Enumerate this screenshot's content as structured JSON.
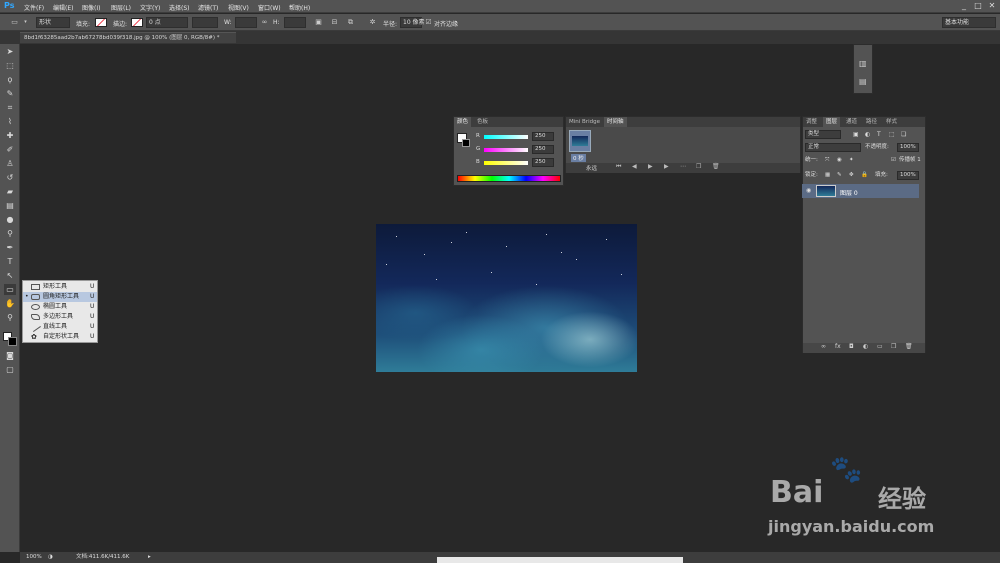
{
  "app": {
    "logo": "Ps"
  },
  "menu": [
    "文件(F)",
    "编辑(E)",
    "图像(I)",
    "图层(L)",
    "文字(Y)",
    "选择(S)",
    "滤镜(T)",
    "视图(V)",
    "窗口(W)",
    "帮助(H)"
  ],
  "window_controls": {
    "minimize": "_",
    "maximize": "□",
    "close": "✕"
  },
  "options_bar": {
    "shape_mode": "形状",
    "fill_label": "填充:",
    "stroke_label": "描边:",
    "stroke_size": "0 点",
    "w_label": "W:",
    "h_label": "H:",
    "radius_label": "半径:",
    "radius_value": "10 像素",
    "align_edges_label": "对齐边缘",
    "workspace": "基本功能"
  },
  "document_tab": {
    "title": "8bd1f63285aad2b7ab67278bd039f318.jpg @ 100% (图层 0, RGB/8#) *"
  },
  "tool_flyout": {
    "items": [
      {
        "label": "矩形工具",
        "key": "U",
        "selected": false
      },
      {
        "label": "圆角矩形工具",
        "key": "U",
        "selected": true
      },
      {
        "label": "椭圆工具",
        "key": "U",
        "selected": false
      },
      {
        "label": "多边形工具",
        "key": "U",
        "selected": false
      },
      {
        "label": "直线工具",
        "key": "U",
        "selected": false
      },
      {
        "label": "自定形状工具",
        "key": "U",
        "selected": false
      }
    ]
  },
  "color_panel": {
    "tabs": [
      "颜色",
      "色板"
    ],
    "channels": [
      {
        "label": "R",
        "value": "250",
        "color": "#ff6699"
      },
      {
        "label": "G",
        "value": "250",
        "color": "#cc44cc"
      },
      {
        "label": "B",
        "value": "250",
        "color": "#dddd33"
      }
    ]
  },
  "timeline_panel": {
    "tabs": [
      "Mini Bridge",
      "时间轴"
    ],
    "frame_time": "0 秒",
    "loop": "永远"
  },
  "layers_panel": {
    "tabs": [
      "调整",
      "图层",
      "通道",
      "路径",
      "样式"
    ],
    "filter_kind": "类型",
    "blend_mode": "正常",
    "opacity_label": "不透明度:",
    "opacity_value": "100%",
    "unify_label": "统一:",
    "propagate_label": "传播帧 1",
    "lock_label": "锁定:",
    "fill_label": "填充:",
    "fill_value": "100%",
    "layers": [
      {
        "name": "图层 0",
        "visible": true
      }
    ]
  },
  "status_bar": {
    "zoom": "100%",
    "doc_info": "文档:411.6K/411.6K"
  },
  "watermark": {
    "brand": "Bai",
    "brand_suffix": "经验",
    "url": "jingyan.baidu.com"
  }
}
